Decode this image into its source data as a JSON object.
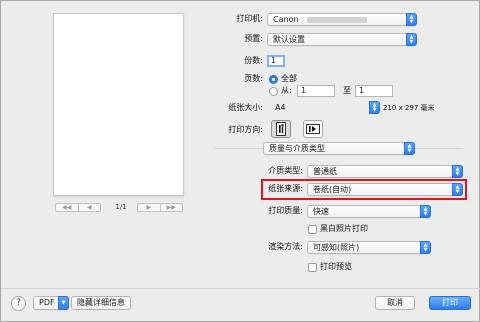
{
  "printer": {
    "label": "打印机:",
    "value": "Canon"
  },
  "presets": {
    "label": "预置:",
    "value": "默认设置"
  },
  "copies": {
    "label": "份数:",
    "value": "1"
  },
  "pages": {
    "label": "页数:",
    "all_label": "全部",
    "from_label": "从:",
    "from_value": "1",
    "to_label": "至",
    "to_value": "1"
  },
  "paper_size": {
    "label": "纸张大小:",
    "value": "A4",
    "dimensions": "210 x 297 毫米"
  },
  "orientation": {
    "label": "打印方向:"
  },
  "section_menu": {
    "value": "质量与介质类型"
  },
  "media_type": {
    "label": "介质类型:",
    "value": "普通纸"
  },
  "paper_source": {
    "label": "纸张来源:",
    "value": "卷纸(自动)"
  },
  "print_quality": {
    "label": "打印质量:",
    "value": "快速"
  },
  "grayscale": {
    "label": "黑白照片打印"
  },
  "rendering": {
    "label": "渲染方法:",
    "value": "可感知(照片)"
  },
  "print_preview": {
    "label": "打印预览"
  },
  "preview": {
    "page_counter": "1/1"
  },
  "footer": {
    "help": "?",
    "pdf": "PDF",
    "hide_details": "隐藏详细信息",
    "cancel": "取消",
    "print": "打印"
  },
  "colors": {
    "accent": "#2d7ff0",
    "highlight": "#e1141b"
  }
}
